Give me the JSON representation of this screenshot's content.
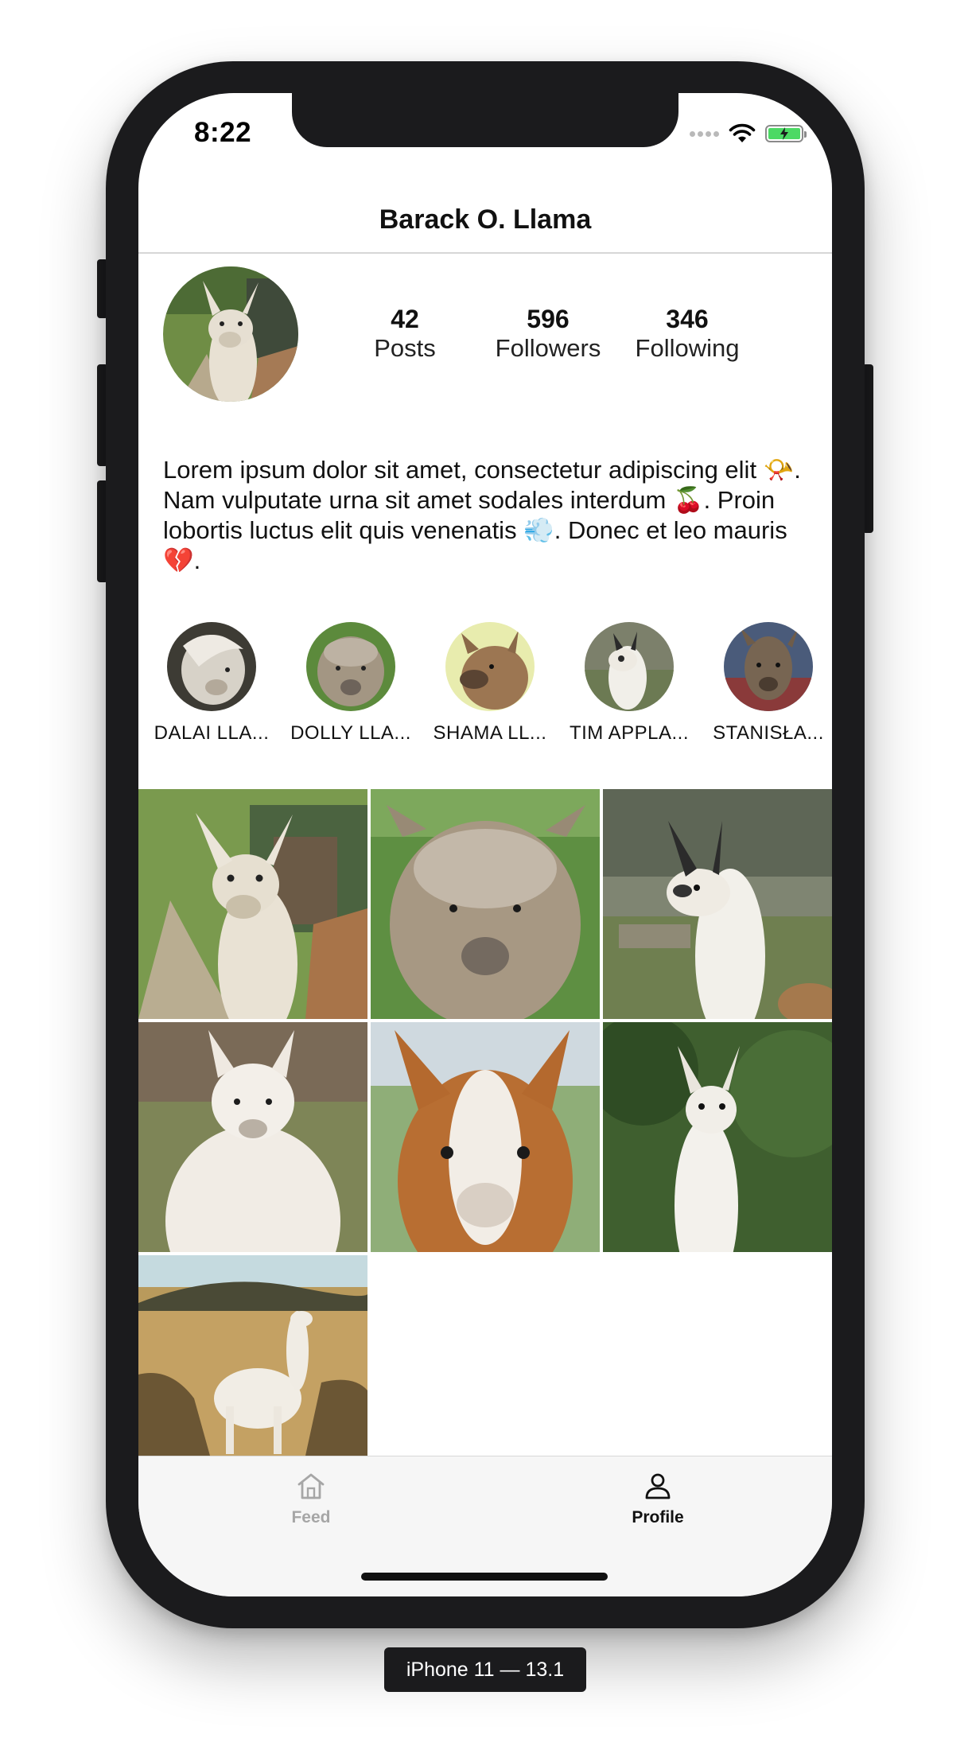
{
  "status_bar": {
    "time": "8:22"
  },
  "header": {
    "title": "Barack O. Llama"
  },
  "profile": {
    "stats": [
      {
        "value": "42",
        "label": "Posts"
      },
      {
        "value": "596",
        "label": "Followers"
      },
      {
        "value": "346",
        "label": "Following"
      }
    ],
    "bio": "Lorem ipsum dolor sit amet, consectetur adipiscing elit 📯. Nam vulputate urna sit amet sodales interdum 🍒. Proin lobortis luctus elit quis venenatis 💨. Donec et leo mauris 💔."
  },
  "highlights": [
    {
      "name": "DALAI LLA..."
    },
    {
      "name": "DOLLY LLA..."
    },
    {
      "name": "SHAMA LL..."
    },
    {
      "name": "TIM APPLA..."
    },
    {
      "name": "STANISŁA..."
    }
  ],
  "tabs": [
    {
      "label": "Feed",
      "icon": "home-icon",
      "active": false
    },
    {
      "label": "Profile",
      "icon": "person-icon",
      "active": true
    }
  ],
  "device_caption": "iPhone 11 — 13.1",
  "colors": {
    "frame": "#1b1b1d",
    "battery_fill": "#4cd964",
    "tab_inactive": "#a6a6a6",
    "tab_active": "#111111"
  }
}
